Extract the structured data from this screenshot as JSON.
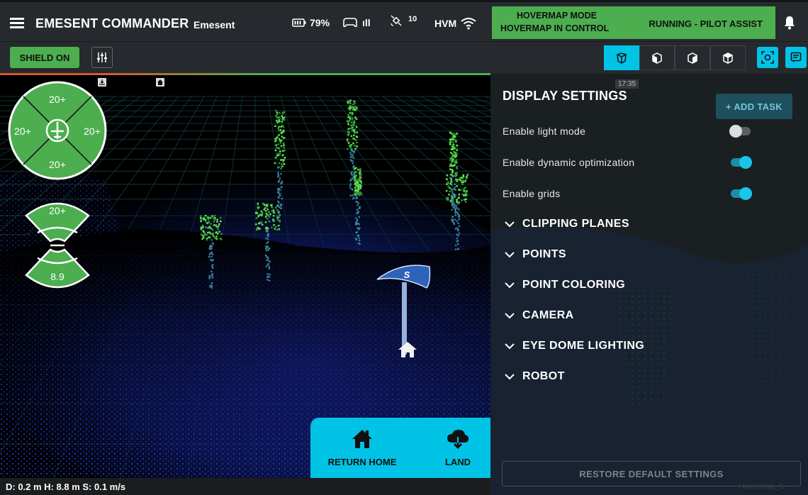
{
  "header": {
    "app_title": "EMESENT COMMANDER",
    "app_subtitle": "Emesent",
    "battery": "79%",
    "remote_signal": "ıll",
    "satellites": "10",
    "link_name": "HVM",
    "mode_line1": "HOVERMAP MODE",
    "mode_line2": "HOVERMAP IN CONTROL",
    "run_status": "RUNNING - PILOT ASSIST"
  },
  "toolbar": {
    "shield_label": "SHIELD ON"
  },
  "viewport": {
    "proximity": {
      "top": "20+",
      "left": "20+",
      "right": "20+",
      "bottom": "20+",
      "upper": "20+",
      "lower": "8.9"
    },
    "waypoint_label": "S"
  },
  "status_bar": {
    "text": "D: 0.2 m  H: 8.8 m  S: 0.1 m/s"
  },
  "actions": {
    "return_home": "RETURN HOME",
    "land": "LAND"
  },
  "panel": {
    "title": "DISPLAY SETTINGS",
    "time_chip": "17:35",
    "add_task": "+ ADD TASK",
    "settings": [
      {
        "label": "Enable light mode",
        "enabled": false
      },
      {
        "label": "Enable dynamic optimization",
        "enabled": true
      },
      {
        "label": "Enable grids",
        "enabled": true
      }
    ],
    "sections": [
      "CLIPPING PLANES",
      "POINTS",
      "POINT COLORING",
      "CAMERA",
      "EYE DOME LIGHTING",
      "ROBOT"
    ],
    "restore_label": "RESTORE DEFAULT SETTINGS",
    "watermark": "Hovermap_S"
  },
  "colors": {
    "accent_cyan": "#00c3e6",
    "mode_green": "#4cae4f",
    "toolbar_bg": "#26292d",
    "panel_bg": "#1a1f22"
  },
  "icons": [
    "menu-icon",
    "battery-icon",
    "controller-icon",
    "satellite-icon",
    "wifi-icon",
    "bell-icon",
    "tune-icon",
    "cube-icon",
    "focus-icon",
    "message-icon",
    "home-icon",
    "cloud-download-icon",
    "chevron-down-icon"
  ]
}
